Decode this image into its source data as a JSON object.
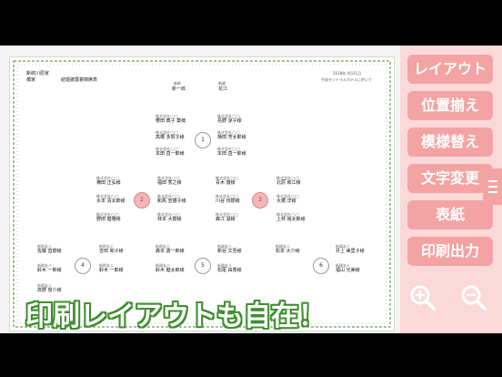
{
  "paper": {
    "family_groom": "新郎川原家",
    "family_bride": "橋家",
    "title": "結婚披露宴御席表",
    "date": "2018年 4月21日",
    "venue": "平成セントラルホテルに於いて",
    "groom_label": "新郎",
    "groom_name": "新一郎",
    "bride_label": "新婦",
    "bride_name": "花江",
    "tables": [
      {
        "no": "1",
        "highlight": false
      },
      {
        "no": "2",
        "highlight": true
      },
      {
        "no": "3",
        "highlight": true
      },
      {
        "no": "4",
        "highlight": false
      },
      {
        "no": "5",
        "highlight": false
      },
      {
        "no": "6",
        "highlight": false
      }
    ],
    "seats": [
      {
        "rel": "株式会社◯◯",
        "name": "櫻田 典子 薬様"
      },
      {
        "rel": "株式会社◯◯",
        "name": "島野 涼子様"
      },
      {
        "rel": "株式会社◯◯",
        "name": "高橋 多賀子様"
      },
      {
        "rel": "株式会社◯◯",
        "name": "樋田 芳太郎様"
      },
      {
        "rel": "株式会社◯◯",
        "name": "本田 直一郎様"
      },
      {
        "rel": "株式会社◯◯",
        "name": "本田 直一郎様"
      },
      {
        "rel": "株式会社◯◯",
        "name": "横田 正弘様"
      },
      {
        "rel": "株式会社◯◯",
        "name": "福田 秀之様"
      },
      {
        "rel": "株式会社◯◯",
        "name": "水本 清太郎様"
      },
      {
        "rel": "株式会社◯◯",
        "name": "和馬 宣雄子様"
      },
      {
        "rel": "株式会社◯◯",
        "name": "野田 健雅様"
      },
      {
        "rel": "株式会社◯◯",
        "name": "林本 大樹様"
      },
      {
        "rel": "株式会社◯◯",
        "name": "青木 徹様"
      },
      {
        "rel": "株式会社◯◯",
        "name": "川谷 伐樹様"
      },
      {
        "rel": "株式会社◯◯",
        "name": "森江 滋様"
      },
      {
        "rel": "株式会社◯◯",
        "name": "北原 和江様"
      },
      {
        "rel": "株式会社◯◯",
        "name": "大橋 洋様"
      },
      {
        "rel": "株式会社◯◯",
        "name": "上林 裕太郎様"
      },
      {
        "rel": "新郎友人",
        "name": "佐藤 直樹様"
      },
      {
        "rel": "新郎友人",
        "name": "鈴木 一郎様"
      },
      {
        "rel": "新郎友人",
        "name": "高野 俊介様"
      },
      {
        "rel": "新郎友人",
        "name": "吉田 和子様"
      },
      {
        "rel": "新郎友人",
        "name": "鈴木 一郎様"
      },
      {
        "rel": "新郎友人",
        "name": "森本 勇一郎様"
      },
      {
        "rel": "新婦友人",
        "name": "新谷 文吾様"
      },
      {
        "rel": "新婦友人",
        "name": "鈴木 健太郎様"
      },
      {
        "rel": "新婦友人",
        "name": "松尾 由香様"
      },
      {
        "rel": "新婦友人",
        "name": "松本 大介様"
      },
      {
        "rel": "新婦友人",
        "name": "井上 美里子様"
      },
      {
        "rel": "新婦友人",
        "name": "福山 光美様"
      }
    ]
  },
  "sidebar": {
    "buttons": [
      "レイアウト",
      "位置揃え",
      "模様替え",
      "文字変更",
      "表紙",
      "印刷出力"
    ],
    "zoom_in_icon": "zoom-in-icon",
    "zoom_out_icon": "zoom-out-icon",
    "handle_icon": "menu-icon"
  },
  "caption": "印刷レイアウトも自在！",
  "colors": {
    "accent": "#f3a3a3",
    "sidebar_bg": "#fbd9d9",
    "caption_outline": "#3f8f2f",
    "vine": "#4a8a3a",
    "highlight_table": "#f4b6b6"
  }
}
